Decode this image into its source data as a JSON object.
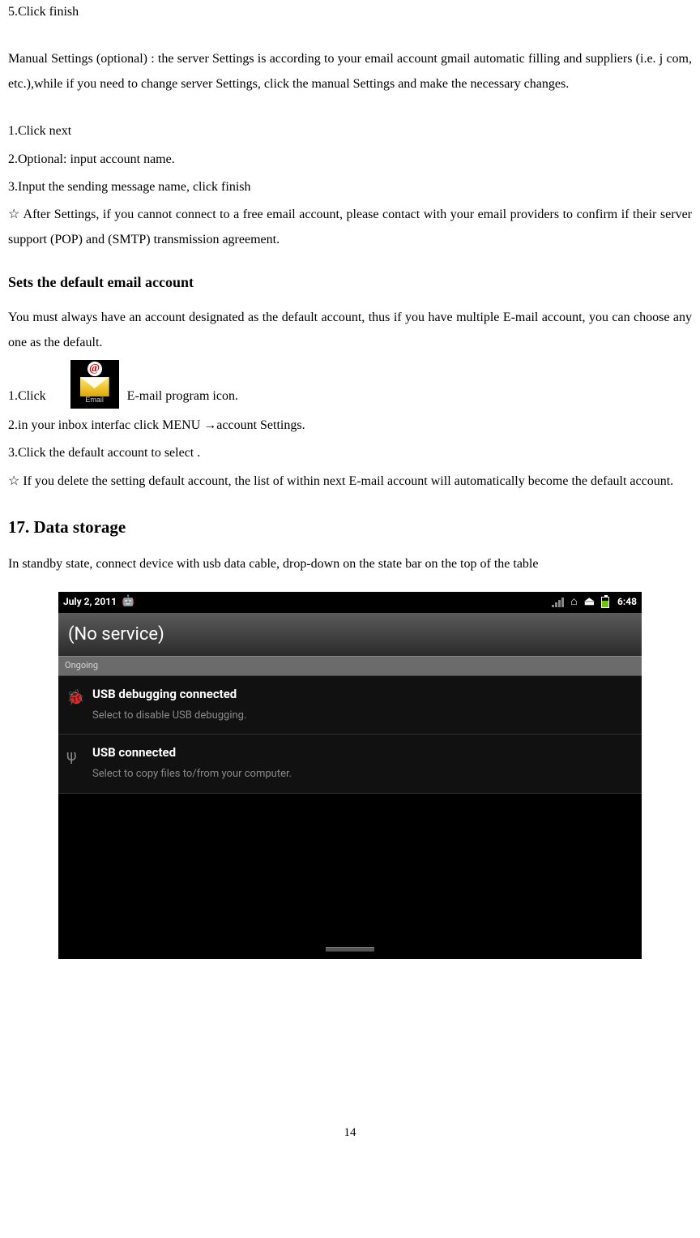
{
  "body": {
    "p0": "5.Click finish",
    "p1": "Manual Settings (optional) : the server Settings is according to your email account gmail automatic filling and suppliers (i.e. j com, etc.),while   if you need to change server Settings, click the manual Settings and make the necessary changes.",
    "p2": "1.Click next",
    "p3": "2.Optional: input account name.",
    "p4": "3.Input the   sending   message name, click finish",
    "p5": "☆ After Settings, if you cannot connect to a free email account, please contact with your email providers to confirm if   their server support (POP) and (SMTP) transmission agreement.",
    "h_default": "Sets the default email account",
    "p6": "You must always have an account designated as the default account, thus if you have multiple E-mail account, you can choose any one as the default.",
    "p7_pre": "1.Click",
    "p7_post": "E-mail program icon.",
    "email_icon_label": "Email",
    "p8": "2.in your inbox interfac click MENU →account Settings.",
    "p9": "3.Click the default account to select .",
    "p10": "☆ If you delete the setting default account, the list of within next E-mail account will automatically become the default account.",
    "h_storage": "17. Data storage",
    "p11": "In standby state, connect device with usb data cable, drop-down on the state bar on the top of the table"
  },
  "screenshot": {
    "date": "July 2, 2011",
    "time": "6:48",
    "service": "(No service)",
    "section": "Ongoing",
    "notif1": {
      "title": "USB debugging connected",
      "sub": "Select to disable USB debugging."
    },
    "notif2": {
      "title": "USB connected",
      "sub": "Select to copy files to/from your computer."
    }
  },
  "page_number": "14"
}
